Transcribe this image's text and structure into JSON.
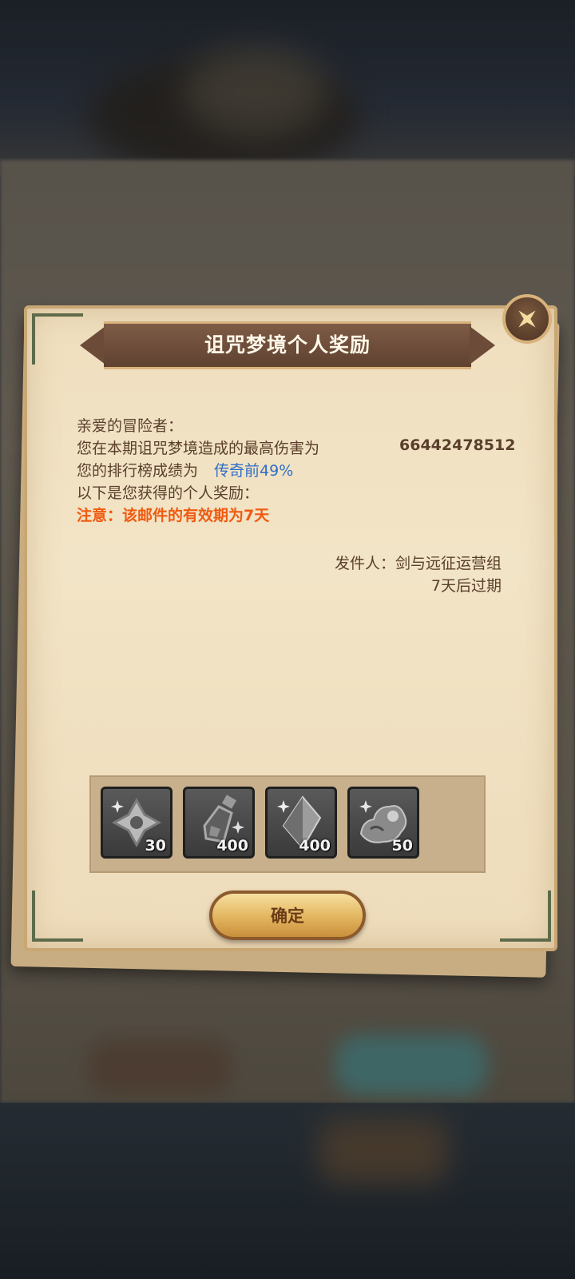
{
  "dialog": {
    "title": "诅咒梦境个人奖励",
    "close_icon": "close-icon"
  },
  "mail": {
    "greeting": "亲爱的冒险者：",
    "damage_label": "您在本期诅咒梦境造成的最高伤害为",
    "damage_value": "66442478512",
    "rank_label": "您的排行榜成绩为",
    "rank_tier": "传奇前",
    "rank_percent": "49%",
    "reward_intro": "以下是您获得的个人奖励：",
    "notice": "注意：该邮件的有效期为7天",
    "sender": "发件人：剑与远征运营组",
    "expire": "7天后过期"
  },
  "rewards": [
    {
      "icon": "four-point-star-icon",
      "qty": "30"
    },
    {
      "icon": "potion-bottle-icon",
      "qty": "400"
    },
    {
      "icon": "crystal-shard-icon",
      "qty": "400"
    },
    {
      "icon": "beast-figure-icon",
      "qty": "50"
    }
  ],
  "buttons": {
    "confirm": "确定"
  },
  "colors": {
    "title_text": "#fff7e8",
    "body_text": "#5a3f2c",
    "rank_highlight": "#2f6ec9",
    "notice": "#f05a10"
  }
}
